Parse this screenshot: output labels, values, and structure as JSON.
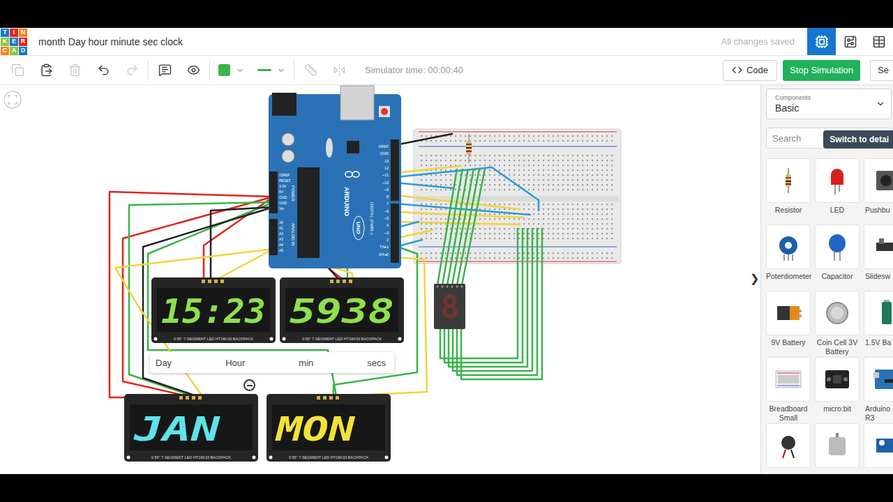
{
  "window": {
    "title": "month Day hour minute sec clock",
    "save_status": "All changes saved"
  },
  "logo": [
    {
      "text": "T",
      "color": "#1477d1"
    },
    {
      "text": "I",
      "color": "#e2231a"
    },
    {
      "text": "N",
      "color": "#f58220"
    },
    {
      "text": "K",
      "color": "#8cc63f"
    },
    {
      "text": "E",
      "color": "#1477d1"
    },
    {
      "text": "R",
      "color": "#e2231a"
    },
    {
      "text": "C",
      "color": "#f58220"
    },
    {
      "text": "A",
      "color": "#8cc63f"
    },
    {
      "text": "D",
      "color": "#1477d1"
    }
  ],
  "view_switch": [
    {
      "kind": "circuit",
      "selected": true
    },
    {
      "kind": "schematic",
      "selected": false
    },
    {
      "kind": "parts",
      "selected": false
    }
  ],
  "toolbar": {
    "groups": [
      [
        {
          "kind": "copy",
          "disabled": true
        },
        {
          "kind": "paste",
          "disabled": false
        },
        {
          "kind": "delete",
          "disabled": true
        },
        {
          "kind": "undo",
          "disabled": false
        },
        {
          "kind": "redo",
          "disabled": true
        }
      ],
      [
        {
          "kind": "notes",
          "disabled": false
        },
        {
          "kind": "visibility",
          "disabled": false
        }
      ],
      [
        {
          "kind": "color",
          "disabled": false
        },
        {
          "kind": "linetype",
          "disabled": false
        }
      ],
      [
        {
          "kind": "ruler",
          "disabled": true
        },
        {
          "kind": "mirror",
          "disabled": true
        }
      ]
    ],
    "wire_color": "#3cb44a",
    "simulator_time": "Simulator time: 00:00:40",
    "code_button": "Code",
    "simulation_button": "Stop Simulation",
    "send_button": "Se"
  },
  "canvas": {
    "collapse_handle": "❯",
    "note": {
      "labels": [
        "Day",
        "Hour",
        "min",
        "secs"
      ]
    },
    "board": {
      "name": "ARDUINO",
      "model": "UNO",
      "digital_label": "DIGITAL (PWM~)",
      "power_label": "POWER",
      "analog_label": "ANALOG IN",
      "digital_pins": [
        "AREF",
        "GND",
        "13",
        "12",
        "~11",
        "~10",
        "~9",
        "8",
        "7",
        "~6",
        "~5",
        "4",
        "~3",
        "2",
        "TX▸1",
        "RX◂0"
      ],
      "power_pins": [
        "IOREF",
        "RESET",
        "3.3V",
        "5V",
        "GND",
        "GND",
        "Vin"
      ],
      "analog_pins": [
        "A0",
        "A1",
        "A2",
        "A3",
        "A4",
        "A5"
      ]
    },
    "displays": [
      {
        "digits": "15:23",
        "color": "#8ee04c",
        "label": "0.56\" 7-SEGMENT LED HT16K33 BACKPACK"
      },
      {
        "digits": "5938",
        "color": "#8ee04c",
        "label": "0.56\" 7-SEGMENT LED HT16K33 BACKPACK"
      },
      {
        "digits": "JAN",
        "color": "#5fe3ea",
        "label": "0.56\" 7-SEGMENT LED HT16K33 BACKPACK"
      },
      {
        "digits": "MON",
        "color": "#f3e23a",
        "label": "0.56\" 7-SEGMENT LED HT16K33 BACKPACK"
      }
    ],
    "single_digit": {
      "digit": "8",
      "lit": false,
      "color": "#e0281e"
    }
  },
  "panel": {
    "heading": "Components",
    "category": "Basic",
    "search_placeholder": "Search",
    "tooltip": "Switch to detai",
    "items": [
      {
        "kind": "resistor",
        "label": "Resistor"
      },
      {
        "kind": "led",
        "label": "LED"
      },
      {
        "kind": "pushbutton",
        "label": "Pushbu"
      },
      {
        "kind": "potentiometer",
        "label": "Potentiometer"
      },
      {
        "kind": "capacitor",
        "label": "Capacitor"
      },
      {
        "kind": "slideswitch",
        "label": "Slidesw"
      },
      {
        "kind": "battery9v",
        "label": "9V Battery"
      },
      {
        "kind": "coincell",
        "label": "Coin Cell 3V Battery"
      },
      {
        "kind": "battery15",
        "label": "1.5V Ba"
      },
      {
        "kind": "breadboard",
        "label": "Breadboard Small"
      },
      {
        "kind": "microbit",
        "label": "micro:bit"
      },
      {
        "kind": "arduino",
        "label": "Arduino\nR3"
      },
      {
        "kind": "vibration"
      },
      {
        "kind": "dcmotor"
      },
      {
        "kind": "servo"
      }
    ]
  }
}
